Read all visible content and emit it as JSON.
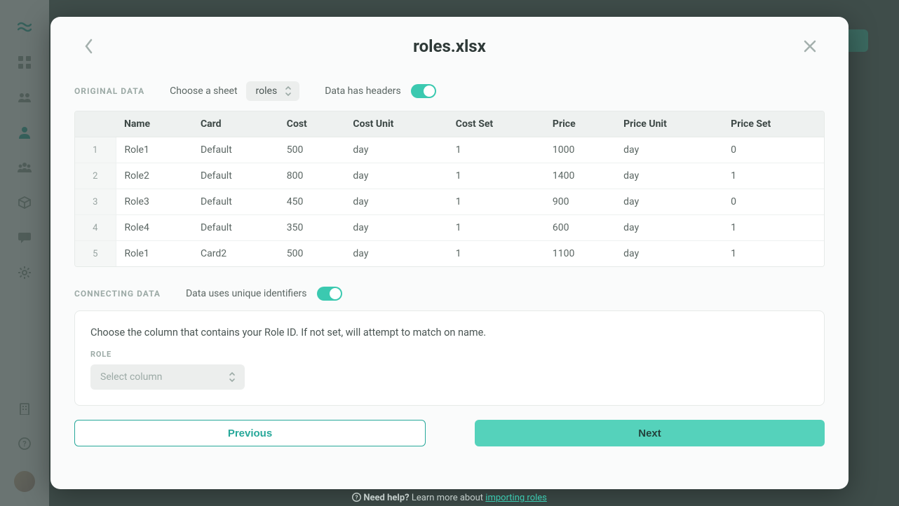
{
  "modal_title": "roles.xlsx",
  "original": {
    "section_label": "ORIGINAL DATA",
    "choose_sheet_label": "Choose a sheet",
    "selected_sheet": "roles",
    "headers_label": "Data has headers",
    "columns": [
      "Name",
      "Card",
      "Cost",
      "Cost Unit",
      "Cost Set",
      "Price",
      "Price Unit",
      "Price Set"
    ],
    "rows": [
      [
        "Role1",
        "Default",
        "500",
        "day",
        "1",
        "1000",
        "day",
        "0"
      ],
      [
        "Role2",
        "Default",
        "800",
        "day",
        "1",
        "1400",
        "day",
        "1"
      ],
      [
        "Role3",
        "Default",
        "450",
        "day",
        "1",
        "900",
        "day",
        "0"
      ],
      [
        "Role4",
        "Default",
        "350",
        "day",
        "1",
        "600",
        "day",
        "1"
      ],
      [
        "Role1",
        "Card2",
        "500",
        "day",
        "1",
        "1100",
        "day",
        "1"
      ]
    ]
  },
  "connecting": {
    "section_label": "CONNECTING DATA",
    "unique_label": "Data uses unique identifiers",
    "hint": "Choose the column that contains your Role ID. If not set, will attempt to match on name.",
    "field_label": "ROLE",
    "placeholder": "Select column"
  },
  "footer": {
    "prev": "Previous",
    "next": "Next"
  },
  "help": {
    "prefix": "Need help?",
    "text": " Learn more about ",
    "link": "importing roles"
  }
}
